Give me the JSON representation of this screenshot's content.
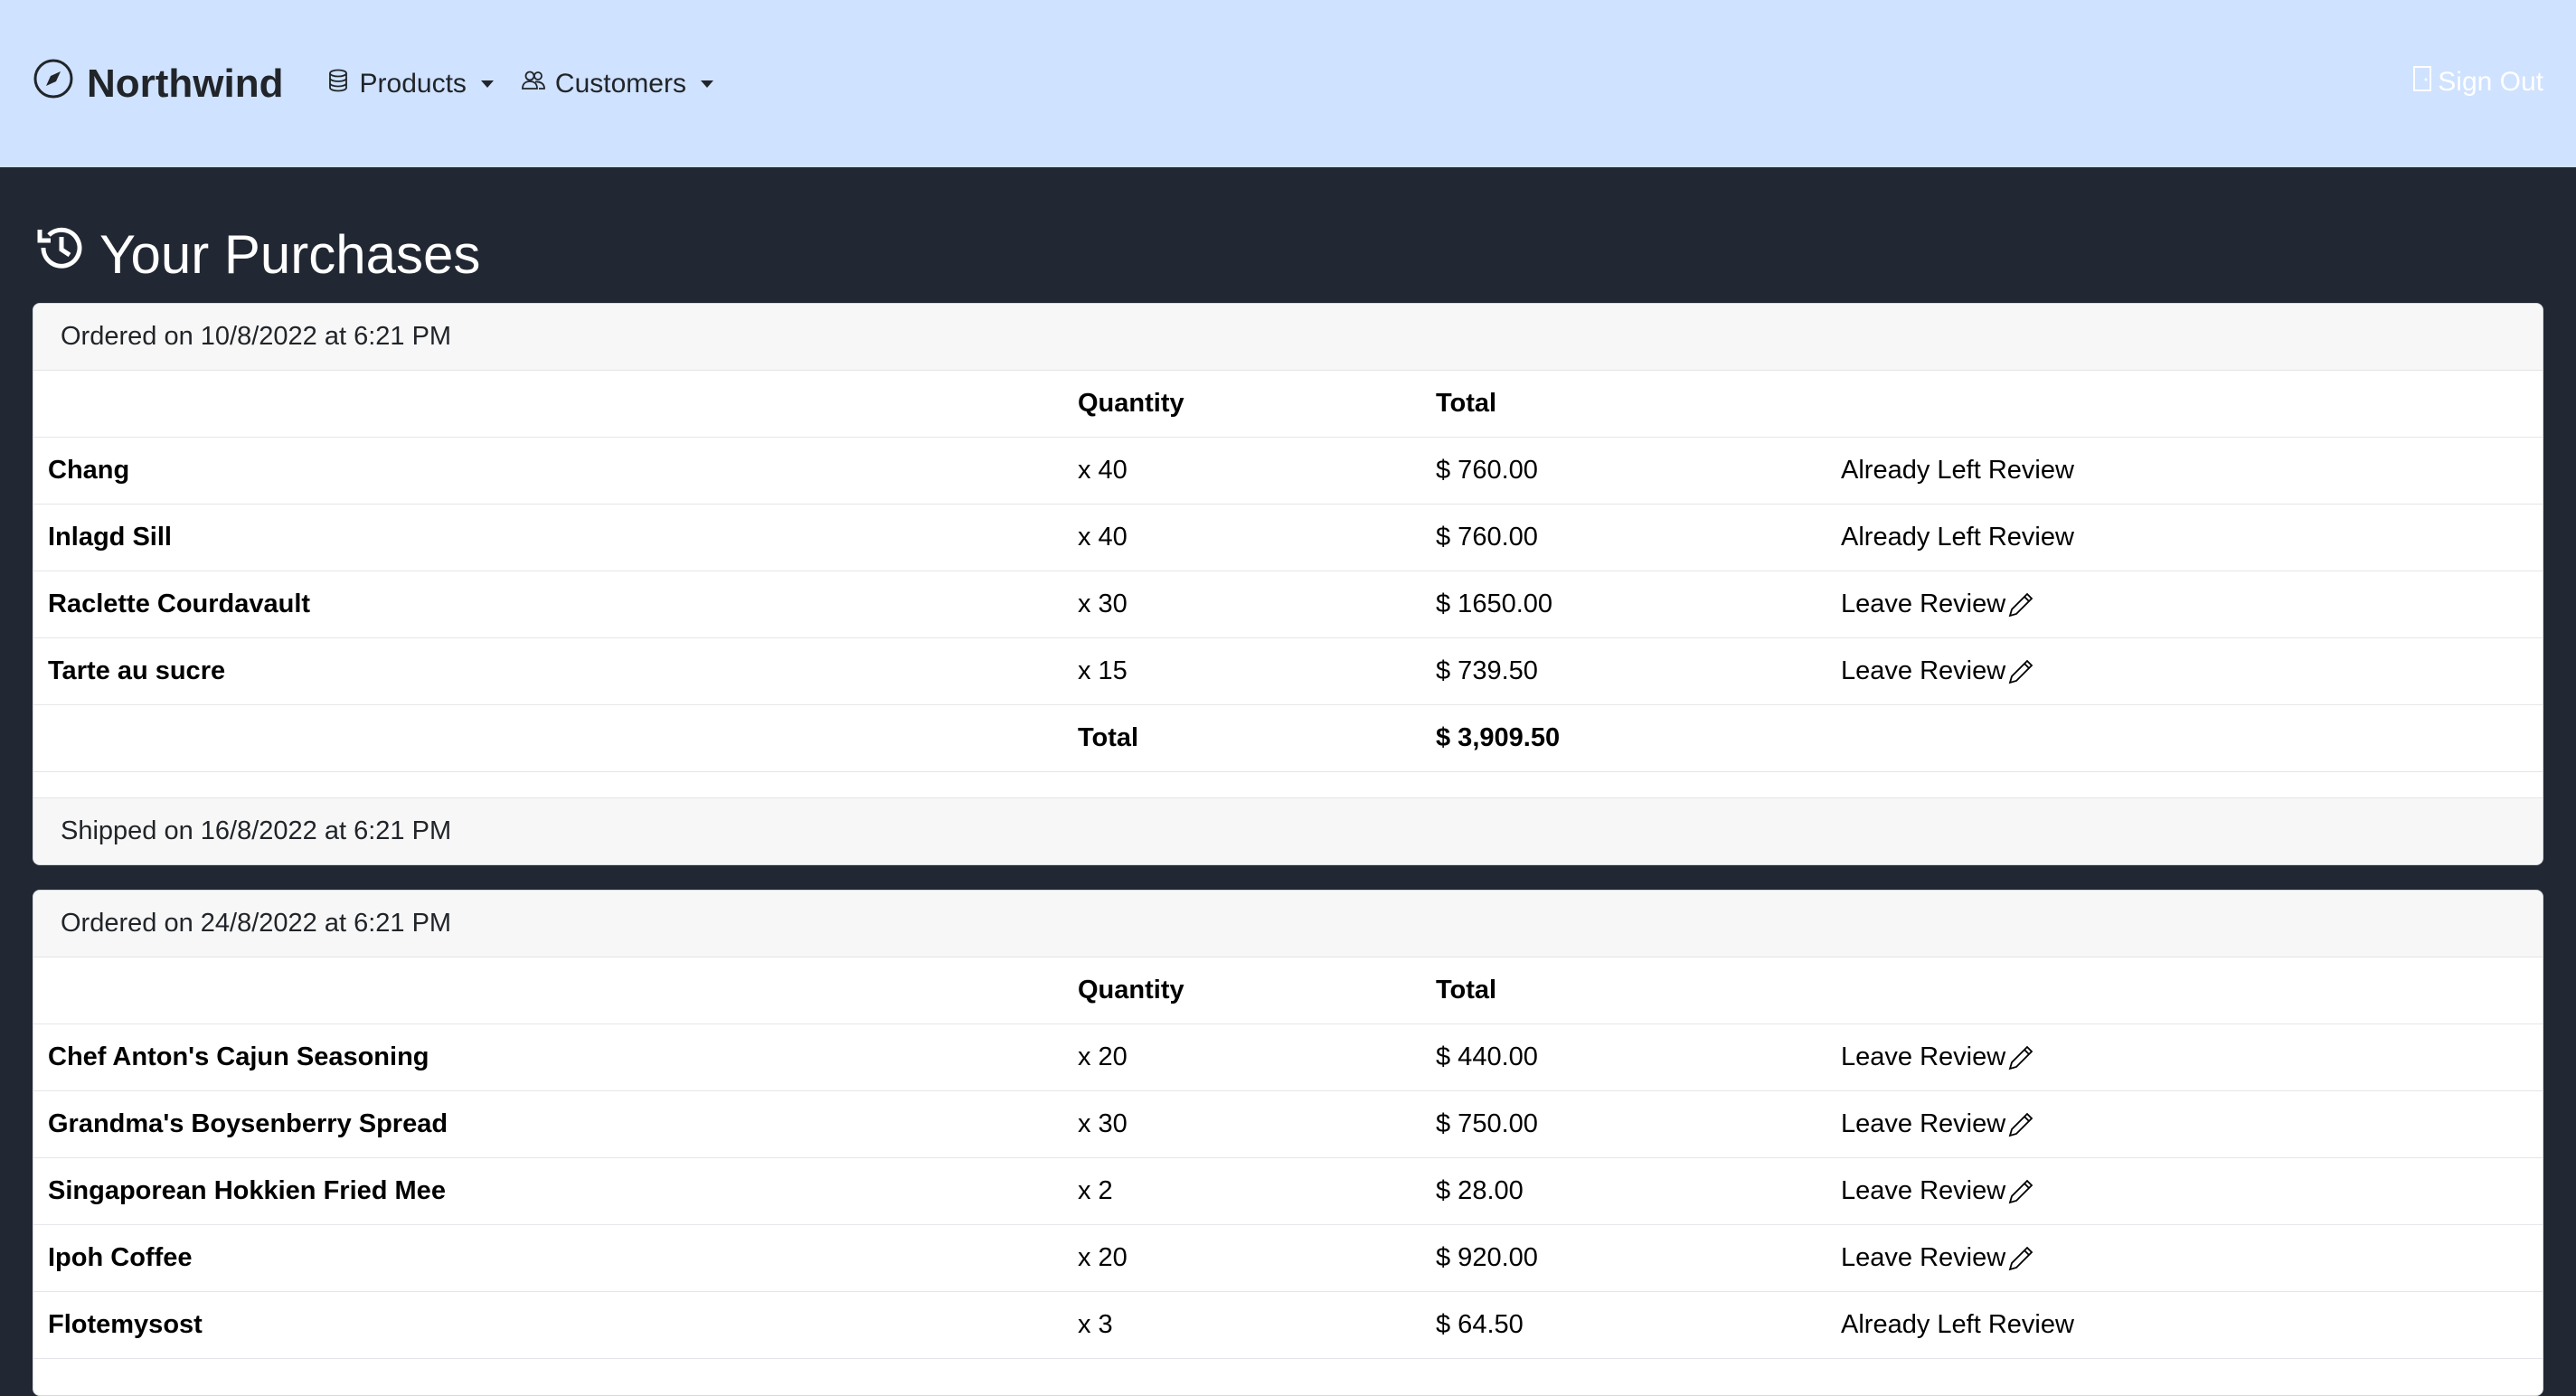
{
  "nav": {
    "brand": "Northwind",
    "products_label": "Products",
    "customers_label": "Customers",
    "signout_label": "Sign Out"
  },
  "page": {
    "title": "Your Purchases"
  },
  "orders": [
    {
      "ordered": "Ordered on 10/8/2022 at 6:21 PM",
      "header": {
        "quantity": "Quantity",
        "total": "Total"
      },
      "items": [
        {
          "name": "Chang",
          "qty": "x 40",
          "total": "$ 760.00",
          "review": "Already Left Review"
        },
        {
          "name": "Inlagd Sill",
          "qty": "x 40",
          "total": "$ 760.00",
          "review": "Already Left Review"
        },
        {
          "name": "Raclette Courdavault",
          "qty": "x 30",
          "total": "$ 1650.00",
          "review": "Leave Review"
        },
        {
          "name": "Tarte au sucre",
          "qty": "x 15",
          "total": "$ 739.50",
          "review": "Leave Review"
        }
      ],
      "total_label": "Total",
      "grand_total": "$ 3,909.50",
      "shipped": "Shipped on 16/8/2022 at 6:21 PM"
    },
    {
      "ordered": "Ordered on 24/8/2022 at 6:21 PM",
      "header": {
        "quantity": "Quantity",
        "total": "Total"
      },
      "items": [
        {
          "name": "Chef Anton's Cajun Seasoning",
          "qty": "x 20",
          "total": "$ 440.00",
          "review": "Leave Review"
        },
        {
          "name": "Grandma's Boysenberry Spread",
          "qty": "x 30",
          "total": "$ 750.00",
          "review": "Leave Review"
        },
        {
          "name": "Singaporean Hokkien Fried Mee",
          "qty": "x 2",
          "total": "$ 28.00",
          "review": "Leave Review"
        },
        {
          "name": "Ipoh Coffee",
          "qty": "x 20",
          "total": "$ 920.00",
          "review": "Leave Review"
        },
        {
          "name": "Flotemysost",
          "qty": "x 3",
          "total": "$ 64.50",
          "review": "Already Left Review"
        }
      ]
    }
  ]
}
